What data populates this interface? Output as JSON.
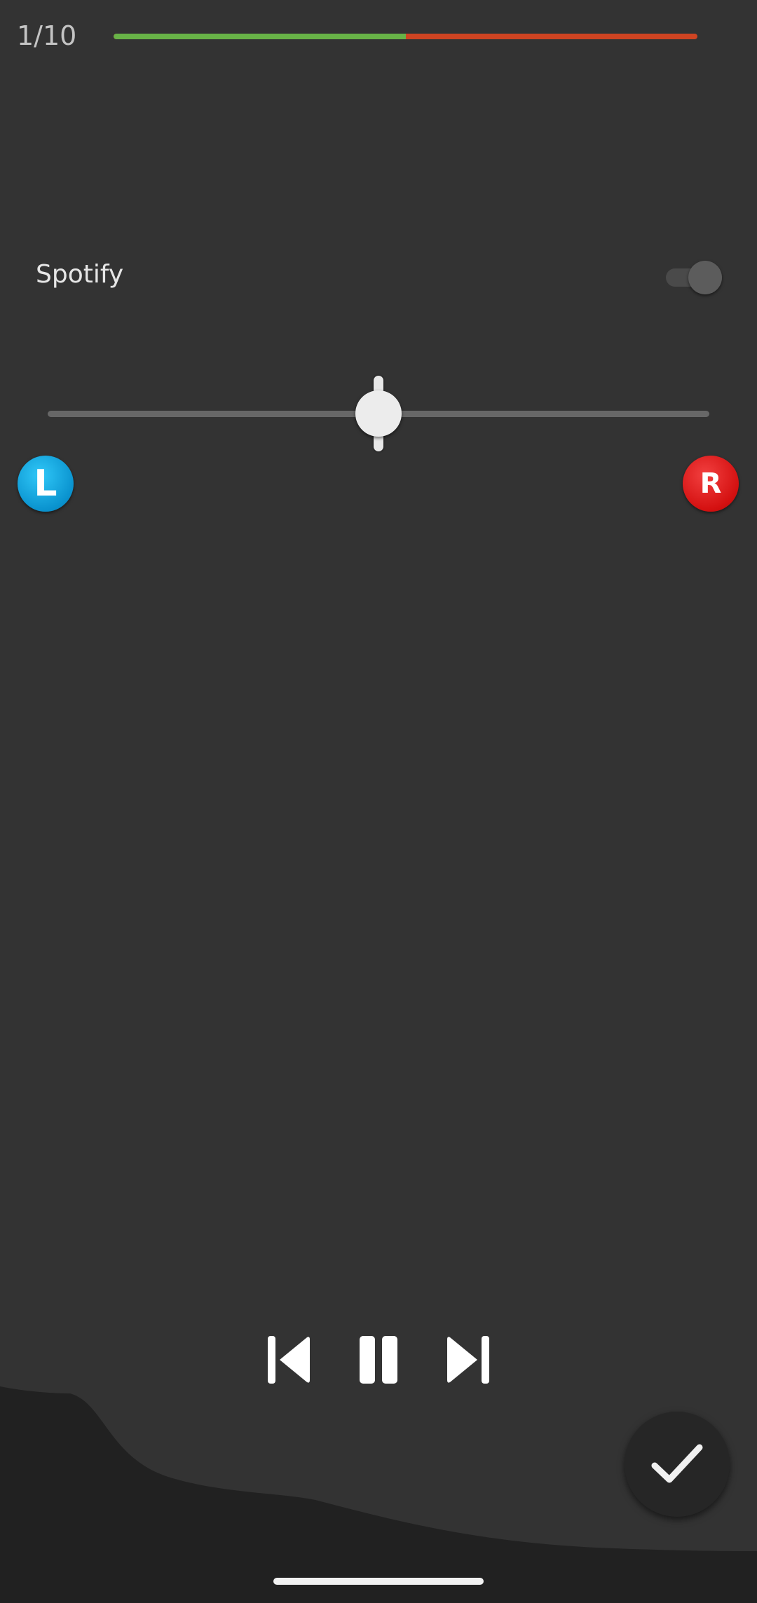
{
  "header": {
    "step_counter": "1/10",
    "progress": {
      "fraction": 0.5,
      "done_color": "#68b347",
      "remaining_color": "#cf4422"
    }
  },
  "source": {
    "label": "Spotify",
    "toggle_on": false
  },
  "balance": {
    "value": 0.5,
    "left_label": "L",
    "right_label": "R",
    "left_color": "#0a93cf",
    "right_color": "#d41010"
  },
  "media_controls": {
    "previous_icon": "skip-previous-icon",
    "pause_icon": "pause-icon",
    "next_icon": "skip-next-icon"
  },
  "confirm": {
    "icon": "check-icon"
  }
}
